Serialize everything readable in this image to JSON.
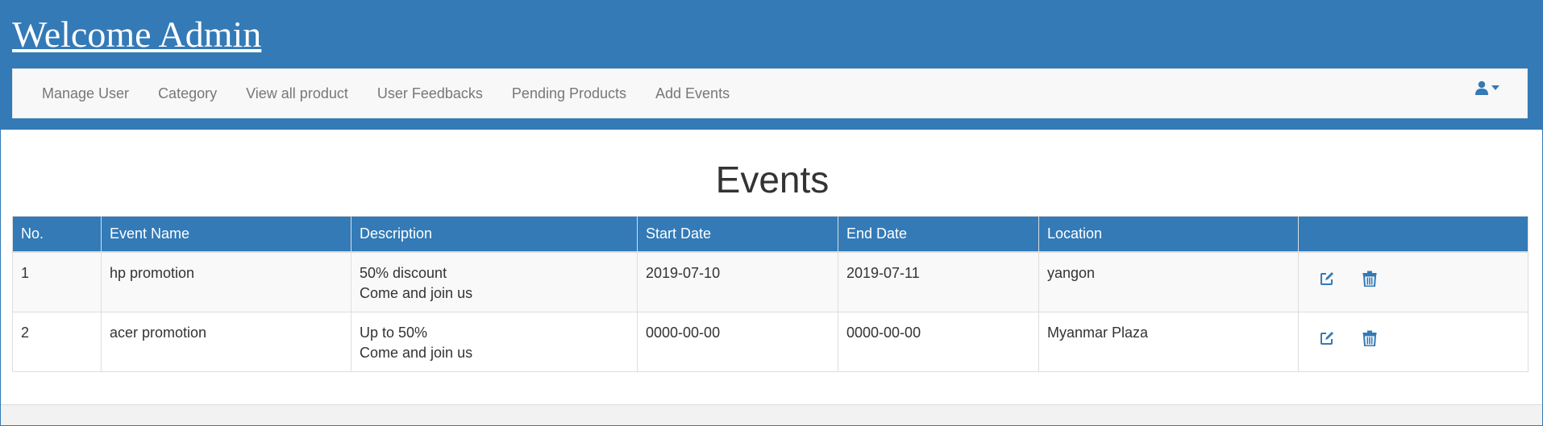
{
  "header": {
    "title": "Welcome Admin"
  },
  "nav": {
    "items": [
      {
        "label": "Manage User"
      },
      {
        "label": "Category"
      },
      {
        "label": "View all product"
      },
      {
        "label": "User Feedbacks"
      },
      {
        "label": "Pending Products"
      },
      {
        "label": "Add Events"
      }
    ],
    "user_icon": "user-icon",
    "caret_icon": "caret-down-icon"
  },
  "main": {
    "title": "Events",
    "table": {
      "columns": [
        "No.",
        "Event Name",
        "Description",
        "Start Date",
        "End Date",
        "Location",
        ""
      ],
      "rows": [
        {
          "no": "1",
          "name": "hp promotion",
          "description": [
            "50% discount",
            "Come and join us"
          ],
          "start": "2019-07-10",
          "end": "2019-07-11",
          "location": "yangon"
        },
        {
          "no": "2",
          "name": "acer promotion",
          "description": [
            "Up to 50%",
            "Come and join us"
          ],
          "start": "0000-00-00",
          "end": "0000-00-00",
          "location": "Myanmar Plaza"
        }
      ],
      "row_actions": [
        "edit-icon",
        "trash-icon"
      ]
    }
  },
  "colors": {
    "primary": "#337ab7",
    "navbar_bg": "#f8f8f8",
    "nav_text": "#777777",
    "text": "#333333"
  }
}
